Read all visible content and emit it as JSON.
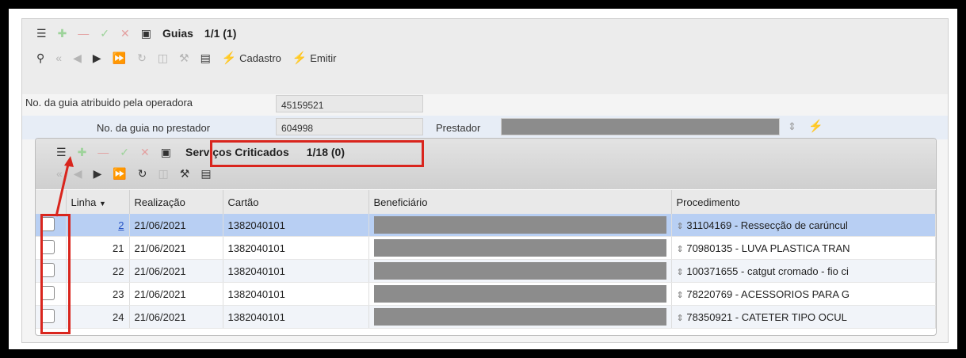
{
  "header": {
    "title": "Guias",
    "pager": "1/1 (1)",
    "cadastro": "Cadastro",
    "emitir": "Emitir"
  },
  "fields": {
    "guia_operadora_label": "No. da guia atribuido pela operadora",
    "guia_operadora_value": "45159521",
    "guia_prestador_label": "No. da guia no prestador",
    "guia_prestador_value": "604998",
    "prestador_label": "Prestador"
  },
  "panel": {
    "title": "Serviços Criticados",
    "pager": "1/18 (0)"
  },
  "table": {
    "headers": {
      "linha": "Linha",
      "realizacao": "Realização",
      "cartao": "Cartão",
      "beneficiario": "Beneficiário",
      "procedimento": "Procedimento"
    },
    "rows": [
      {
        "linha": "2",
        "realizacao": "21/06/2021",
        "cartao": "1382040101",
        "procedimento": "31104169 - Ressecção de carúncul"
      },
      {
        "linha": "21",
        "realizacao": "21/06/2021",
        "cartao": "1382040101",
        "procedimento": "70980135 - LUVA PLASTICA TRAN"
      },
      {
        "linha": "22",
        "realizacao": "21/06/2021",
        "cartao": "1382040101",
        "procedimento": "100371655 - catgut cromado - fio ci"
      },
      {
        "linha": "23",
        "realizacao": "21/06/2021",
        "cartao": "1382040101",
        "procedimento": "78220769 - ACESSORIOS PARA G"
      },
      {
        "linha": "24",
        "realizacao": "21/06/2021",
        "cartao": "1382040101",
        "procedimento": "78350921 - CATETER TIPO OCUL"
      }
    ]
  },
  "colors": {
    "highlight": "#d9251d",
    "selected_row": "#b8cff3",
    "bolt": "#f0c21a"
  }
}
